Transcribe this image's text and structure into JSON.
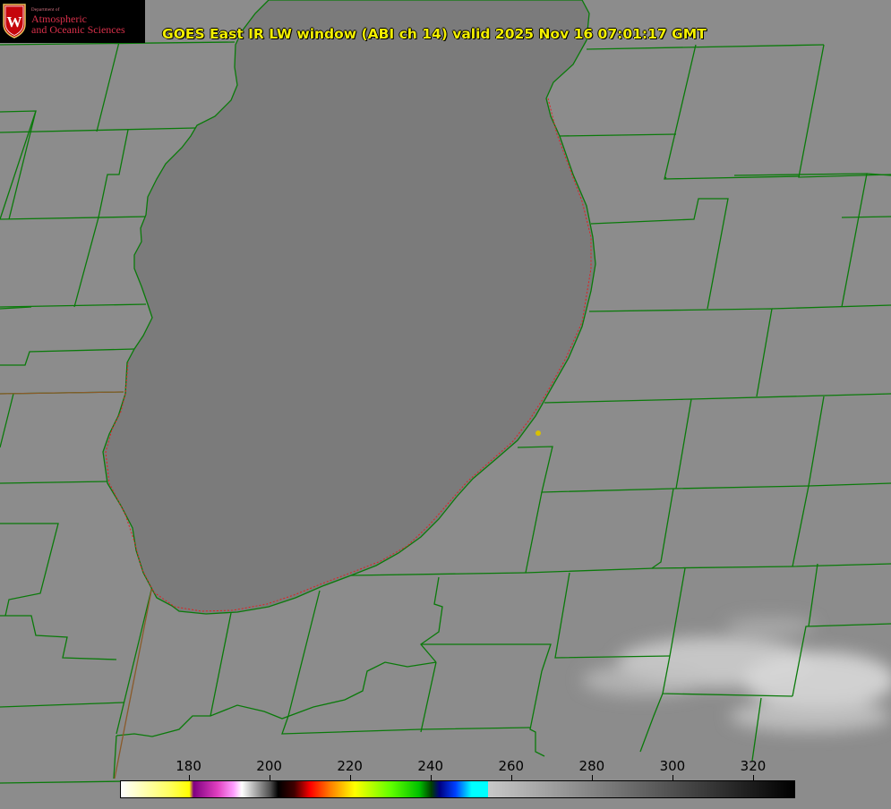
{
  "header": {
    "title": "GOES East IR LW window (ABI ch 14) valid 2025 Nov 16 07:01:17 GMT"
  },
  "logo": {
    "dept_text": "Department of",
    "line1": "Atmospheric",
    "line2": "and Oceanic Sciences",
    "seal_letter": "W",
    "brand_color": "#c5050c"
  },
  "colorbar": {
    "ticks": [
      "180",
      "200",
      "220",
      "240",
      "260",
      "280",
      "300",
      "320"
    ],
    "range": [
      163,
      330
    ],
    "stops": [
      {
        "value": 163,
        "color": "#ffffff"
      },
      {
        "value": 175,
        "color": "#ffff60"
      },
      {
        "value": 180,
        "color": "#ffff00"
      },
      {
        "value": 181,
        "color": "#800080"
      },
      {
        "value": 187,
        "color": "#e040c0"
      },
      {
        "value": 191,
        "color": "#ffa0ff"
      },
      {
        "value": 193,
        "color": "#ffffff"
      },
      {
        "value": 200,
        "color": "#505050"
      },
      {
        "value": 202,
        "color": "#000000"
      },
      {
        "value": 206,
        "color": "#400000"
      },
      {
        "value": 210,
        "color": "#ff0000"
      },
      {
        "value": 215,
        "color": "#ff8000"
      },
      {
        "value": 221,
        "color": "#ffff00"
      },
      {
        "value": 230,
        "color": "#60ff00"
      },
      {
        "value": 237,
        "color": "#00c000"
      },
      {
        "value": 240,
        "color": "#004000"
      },
      {
        "value": 242,
        "color": "#000080"
      },
      {
        "value": 246,
        "color": "#0040ff"
      },
      {
        "value": 250,
        "color": "#00ffff"
      },
      {
        "value": 254,
        "color": "#00ffff"
      },
      {
        "value": 254.1,
        "color": "#c8c8c8"
      },
      {
        "value": 330,
        "color": "#000000"
      }
    ]
  },
  "map": {
    "land_color": "#8c8c8c",
    "lake_color": "#7b7b7b",
    "boundary_color": "#0a7a0a",
    "lake_outline_color": "#e02020",
    "marker_color": "#d8c000",
    "cloud_color": "#d8d8d8"
  }
}
